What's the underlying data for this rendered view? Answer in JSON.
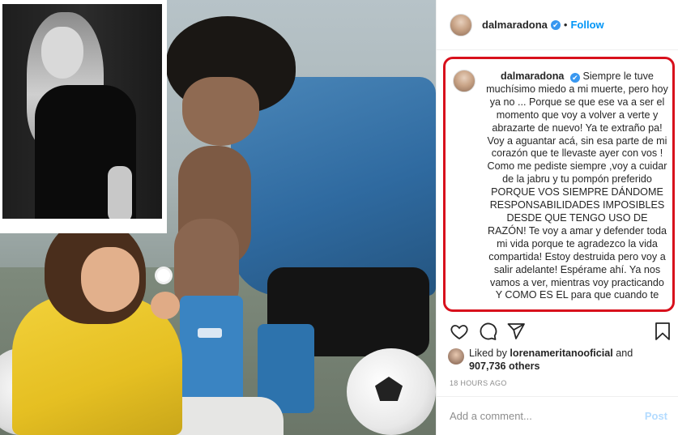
{
  "post": {
    "username": "dalmaradona",
    "follow_label": "Follow",
    "separator": "•",
    "verified_mark": "✔",
    "caption_text": "Siempre le tuve muchísimo miedo a mi muerte, pero hoy ya no ... Porque se que ese va a ser el momento que voy a volver a verte y abrazarte de nuevo! Ya te extraño pa! Voy a aguantar acá, sin esa parte de mi corazón que te llevaste ayer con vos ! Como me pediste siempre ,voy a cuidar de la jabru y tu pompón preferido PORQUE VOS SIEMPRE DÁNDOME RESPONSABILIDADES IMPOSIBLES DESDE QUE TENGO USO DE RAZÓN! Te voy a amar y defender toda mi vida porque te agradezco la vida compartida! Estoy destruida pero voy a salir adelante! Espérame ahí. Ya nos vamos a ver, mientras voy practicando Y COMO ES EL para que cuando te",
    "liked_by_prefix": "Liked by",
    "liked_by_user": "lorenameritanooficial",
    "liked_by_and": "and",
    "likes_count": "907,736 others",
    "timestamp": "18 HOURS AGO",
    "comment_placeholder": "Add a comment...",
    "post_label": "Post"
  },
  "icons": {
    "like": "heart-icon",
    "comment": "comment-icon",
    "share": "paper-plane-icon",
    "save": "bookmark-icon"
  },
  "colors": {
    "follow_blue": "#0095f6",
    "highlight_red": "#d8101c",
    "verified_blue": "#3897f0",
    "post_disabled": "#b3dbff"
  }
}
